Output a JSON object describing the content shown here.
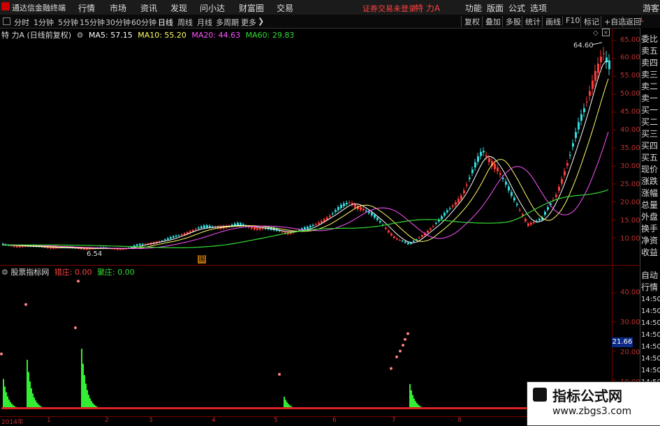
{
  "menubar": {
    "app_title": "通达信金融终端",
    "items": [
      "行情",
      "市场",
      "资讯",
      "发现",
      "问小达",
      "财富圈",
      "交易"
    ],
    "login_status": "证券交易未登录",
    "stock_name": "特 力A",
    "right_items": [
      "功能",
      "版面",
      "公式",
      "选项"
    ],
    "guest": "游客"
  },
  "periodbar": {
    "periods": [
      "分时",
      "1分钟",
      "5分钟",
      "15分钟",
      "30分钟",
      "60分钟",
      "日线",
      "周线",
      "月线",
      "多周期",
      "更多"
    ],
    "active": "日线",
    "tools": [
      "复权",
      "叠加",
      "多股",
      "统计",
      "画线",
      "F10",
      "标记",
      "+自选",
      "返回"
    ]
  },
  "main_legend": {
    "title": "特 力A (日线前复权)",
    "ma5": "MA5: 57.15",
    "ma10": "MA10: 55.20",
    "ma20": "MA20: 44.63",
    "ma60": "MA60: 29.83"
  },
  "indicator_legend": {
    "title": "股票指标网",
    "zhuang1": "猎庄: 0.00",
    "zhuang2": "聚庄: 0.00"
  },
  "annotations": {
    "high": "64.60",
    "low": "6.54",
    "marker": "国",
    "current_value": "21.66"
  },
  "price_axis": [
    "65.00",
    "60.00",
    "55.00",
    "50.00",
    "45.00",
    "40.00",
    "35.00",
    "30.00",
    "25.00",
    "20.00",
    "15.00",
    "10.00"
  ],
  "indicator_axis": [
    "40.00",
    "30.00",
    "20.00",
    "10.00"
  ],
  "x_axis": [
    "2014年",
    "1",
    "2",
    "3",
    "4",
    "5",
    "6",
    "7",
    "8"
  ],
  "right_column": [
    "委比",
    "卖五",
    "卖四",
    "卖三",
    "卖二",
    "卖一",
    "买一",
    "买二",
    "买三",
    "买四",
    "买五",
    "现价",
    "涨跌",
    "涨幅",
    "总量",
    "外盘",
    "换手",
    "净资",
    "收益",
    "自动",
    "行情",
    "14:50",
    "14:50",
    "14:50",
    "14:50",
    "14:50",
    "14:50",
    "14:50",
    "14:50"
  ],
  "watermark": {
    "line1": "指标公式网",
    "line2": "www.zbgs3.com"
  },
  "colors": {
    "up": "#ff3b3b",
    "down": "#33dddd",
    "ma5": "#ffffff",
    "ma10": "#ffff66",
    "ma20": "#ff55ff",
    "ma60": "#33dd33",
    "grid": "#7a0000"
  },
  "chart_data": [
    {
      "type": "line",
      "title": "特 力A (日线前复权)",
      "ylim": [
        6,
        66
      ],
      "series": [
        {
          "name": "MA60",
          "values": [
            7.5,
            7.2,
            7.0,
            7.0,
            7.2,
            8.0,
            9.0,
            10.0,
            11.0,
            12.0,
            13.0,
            14.0,
            15.0,
            15.5,
            16.0,
            17.0,
            18.0,
            19.0,
            19.0,
            20.0,
            23.0,
            27.0,
            29.83
          ]
        },
        {
          "name": "MA20",
          "values": [
            7.8,
            7.3,
            7.0,
            7.0,
            7.5,
            9.0,
            11.0,
            12.0,
            12.5,
            13.0,
            14.5,
            17.0,
            19.0,
            16.0,
            9.5,
            13.0,
            19.0,
            27.0,
            21.0,
            14.5,
            22.0,
            35.0,
            44.63
          ]
        }
      ],
      "y_ticks": [
        "65.00",
        "60.00",
        "55.00",
        "50.00",
        "45.00",
        "40.00",
        "35.00",
        "30.00",
        "25.00",
        "20.00",
        "15.00",
        "10.00"
      ],
      "annotations": [
        "64.60",
        "6.54"
      ]
    },
    {
      "type": "bar",
      "title": "股票指标网",
      "ylim": [
        0,
        48
      ],
      "y_ticks": [
        "40.00",
        "30.00",
        "20.00",
        "10.00"
      ],
      "series": [
        {
          "name": "猎庄",
          "values": [
            0.0
          ]
        },
        {
          "name": "聚庄",
          "values": [
            0.0
          ]
        }
      ]
    }
  ]
}
